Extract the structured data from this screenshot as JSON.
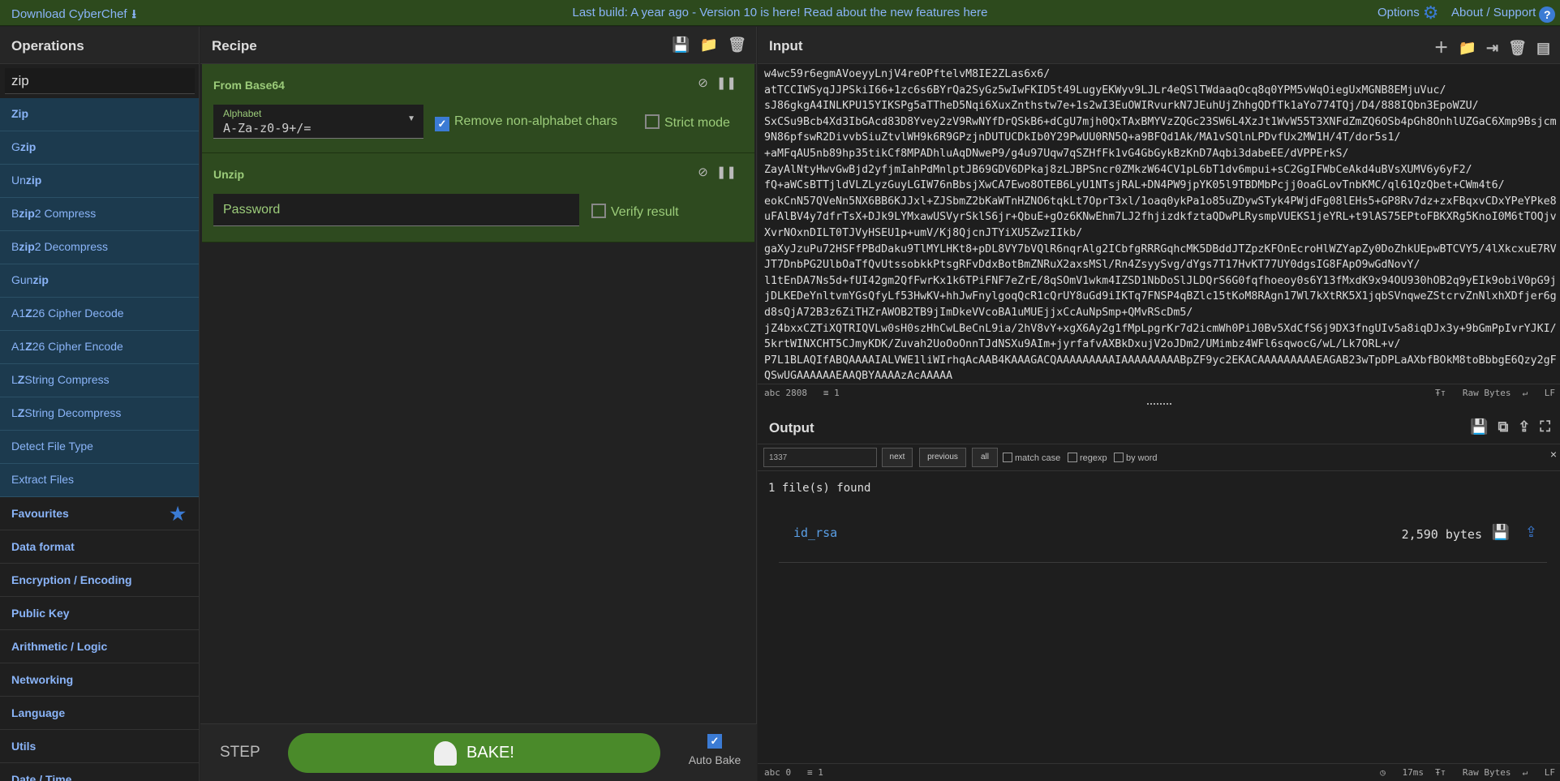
{
  "topbar": {
    "download": "Download CyberChef",
    "notice_prefix": "Last build: A year ago - Version 10 is here! Read about the new features ",
    "notice_link": "here",
    "options": "Options",
    "about": "About / Support"
  },
  "operations": {
    "title": "Operations",
    "search_value": "zip",
    "results": [
      {
        "pre": "",
        "b": "Zip",
        "post": ""
      },
      {
        "pre": "G",
        "b": "zip",
        "post": ""
      },
      {
        "pre": "Un",
        "b": "zip",
        "post": ""
      },
      {
        "pre": "B",
        "b": "zip",
        "post": "2 Compress"
      },
      {
        "pre": "B",
        "b": "zip",
        "post": "2 Decompress"
      },
      {
        "pre": "Gun",
        "b": "zip",
        "post": ""
      },
      {
        "pre": "A1",
        "b": "Z",
        "post": "26 Cipher Decode"
      },
      {
        "pre": "A1",
        "b": "Z",
        "post": "26 Cipher Encode"
      },
      {
        "pre": "L",
        "b": "Z",
        "post": "String Compress"
      },
      {
        "pre": "L",
        "b": "Z",
        "post": "String Decompress"
      },
      {
        "pre": "",
        "b": "",
        "post": "Detect File Type"
      },
      {
        "pre": "",
        "b": "",
        "post": "Extract Files"
      }
    ],
    "categories": [
      "Favourites",
      "Data format",
      "Encryption / Encoding",
      "Public Key",
      "Arithmetic / Logic",
      "Networking",
      "Language",
      "Utils",
      "Date / Time"
    ]
  },
  "recipe": {
    "title": "Recipe",
    "op1": {
      "name": "From Base64",
      "alphabet_label": "Alphabet",
      "alphabet_value": "A-Za-z0-9+/=",
      "remove_label": "Remove non-alphabet chars",
      "strict_label": "Strict mode"
    },
    "op2": {
      "name": "Unzip",
      "password_placeholder": "Password",
      "verify_label": "Verify result"
    },
    "step": "STEP",
    "bake": "BAKE!",
    "autobake": "Auto Bake"
  },
  "input": {
    "title": "Input",
    "text": "w4wc59r6egmAVoeyyLnjV4reOPftelvM8IE2ZLas6x6/\natTCCIWSyqJJPSkiI66+1zc6s6BYrQa2SyGz5wIwFKID5t49LugyEKWyv9LJLr4eQSlTWdaaqOcq8q0YPM5vWqOiegUxMGNB8EMjuVuc/\nsJ86gkgA4INLKPU15YIKSPg5aTTheD5Nqi6XuxZnthstw7e+1s2wI3EuOWIRvurkN7JEuhUjZhhgQDfTk1aYo774TQj/D4/888IQbn3EpoWZU/\nSxCSu9Bcb4Xd3IbGAcd83D8Yvey2zV9RwNYfDrQSkB6+dCgU7mjh0QxTAxBMYVzZQGc23SW6L4XzJt1WvW55T3XNFdZmZQ6OSb4pGh8OnhlUZGaC6Xmp9Bsjcm9N86pfswR2DivvbSiuZtvlWH9k6R9GPzjnDUTUCDkIb0Y29PwUU0RN5Q+a9BFQd1Ak/MA1vSQlnLPDvfUx2MW1H/4T/dor5s1/\n+aMFqAU5nb89hp35tikCf8MPADhluAqDNweP9/g4u97Uqw7qSZHfFk1vG4GbGykBzKnD7Aqbi3dabeEE/dVPPErkS/\nZayAlNtyHwvGwBjd2yfjmIahPdMnlptJB69GDV6DPkaj8zLJBPSncr0ZMkzW64CV1pL6bT1dv6mpui+sC2GgIFWbCeAkd4uBVsXUMV6y6yF2/\nfQ+aWCsBTTjldVLZLyzGuyLGIW76nBbsjXwCA7Ewo8OTEB6LyU1NTsjRAL+DN4PW9jpYK05l9TBDMbPcjj0oaGLovTnbKMC/ql61QzQbet+CWm4t6/\neokCnN57QVeNn5NX6BB6KJJxl+ZJSbmZ2bKaWTnHZNO6tqkLt7OprT3xl/1oaq0ykPa1o85uZDywSTyk4PWjdFg08lEHs5+GP8Rv7dz+zxFBqxvCDxYPeYPke8uFAlBV4y7dfrTsX+DJk9LYMxawUSVyrSklS6jr+QbuE+gOz6KNwEhm7LJ2fhjizdkfztaQDwPLRysmpVUEKS1jeYRL+t9lAS75EPtoFBKXRg5KnoI0M6tTOQjvXvrNOxnDILT0TJVyHSEU1p+umV/Kj8QjcnJTYiXU5ZwzIIkb/\ngaXyJzuPu72HSFfPBdDaku9TlMYLHKt8+pDL8VY7bVQlR6nqrAlg2ICbfgRRRGqhcMK5DBddJTZpzKFOnEcroHlWZYapZy0DoZhkUEpwBTCVY5/4lXkcxuE7RVJT7DnbPG2UlbOaTfQvUtssobkkPtsgRFvDdxBotBmZNRuX2axsMSl/Rn4ZsyySvg/dYgs7T17HvKT77UY0dgsIG8FApO9wGdNovY/\nl1tEnDA7Ns5d+fUI42gm2QfFwrKx1k6TPiFNF7eZrE/8qSOmV1wkm4IZSD1NbDoSlJLDQrS6G0fqfhoeoy0s6Y13fMxdK9x94OU930hOB2q9yEIk9obiV0pG9jjDLKEDeYnltvmYGsQfyLf53HwKV+hhJwFnylgoqQcR1cQrUY8uGd9iIKTq7FNSP4qBZlc15tKoM8RAgn17Wl7kXtRK5X1jqbSVnqweZStcrvZnNlxhXDfjer6gd8sQjA72B3z6ZiTHZrAWOB2TB9jImDkeVVcoBA1uMUEjjxCcAuNpSmp+QMvRScDm5/\njZ4bxxCZTiXQTRIQVLw0sH0szHhCwLBeCnL9ia/2hV8vY+xgX6Ay2g1fMpLpgrKr7d2icmWh0PiJ0Bv5XdCfS6j9DX3fngUIv5a8iqDJx3y+9bGmPpIvrYJKI/5krtWINXCHT5CJmyKDK/Zuvah2UoOoOnnTJdNSXu9AIm+jyrfafvAXBkDxujV2oJDm2/UMimbz4WFl6sqwocG/wL/Lk7ORL+v/\nP7L1BLAQIfABQAAAAIALVWE1liWIrhqAcAAB4KAAAGACQAAAAAAAAAIAAAAAAAAABpZF9yc2EKACAAAAAAAAAEAGAB23wTpDPLaAXbfBOkM8toBbbgE6Qzy2gFQSwUGAAAAAAEAAQBYAAAAzAcAAAAA",
    "status_len": "2808",
    "status_lines": "1",
    "raw_bytes": "Raw Bytes",
    "eol": "LF"
  },
  "output": {
    "title": "Output",
    "find_value": "1337",
    "next": "next",
    "previous": "previous",
    "all": "all",
    "match_case": "match case",
    "regexp": "regexp",
    "by_word": "by word",
    "found": "1 file(s) found",
    "file_name": "id_rsa",
    "file_size": "2,590 bytes",
    "status_len": "0",
    "status_lines": "1",
    "time": "17ms",
    "raw_bytes": "Raw Bytes",
    "eol": "LF"
  }
}
